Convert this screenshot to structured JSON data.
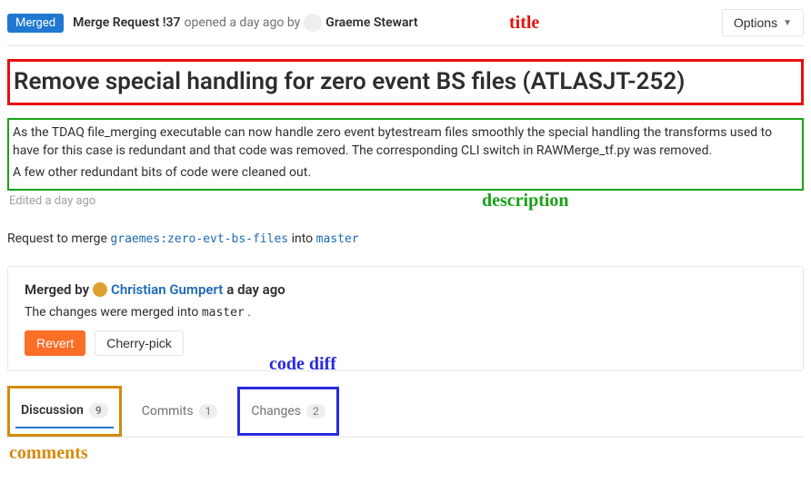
{
  "header": {
    "status_badge": "Merged",
    "mr_label": "Merge Request !37",
    "opened_text": "opened a day ago by",
    "author": "Graeme Stewart"
  },
  "options": {
    "label": "Options"
  },
  "title": "Remove special handling for zero event BS files (ATLASJT-252)",
  "description": {
    "p1": "As the TDAQ file_merging executable can now handle zero event bytestream files smoothly the special handling the transforms used to have for this case is redundant and that code was removed. The corresponding CLI switch in RAWMerge_tf.py was removed.",
    "p2": "A few other redundant bits of code were cleaned out."
  },
  "edited_text": "Edited a day ago",
  "merge_request_line": {
    "prefix": "Request to merge",
    "src_user": "graemes",
    "src_branch": "zero-evt-bs-files",
    "into": "into",
    "target_branch": "master"
  },
  "merged_box": {
    "merged_by_label": "Merged by",
    "merged_user": "Christian Gumpert",
    "merged_when": "a day ago",
    "sub_prefix": "The changes were merged into",
    "sub_branch": "master",
    "sub_suffix": ".",
    "revert": "Revert",
    "cherry": "Cherry-pick"
  },
  "tabs": {
    "discussion": {
      "label": "Discussion",
      "count": "9"
    },
    "commits": {
      "label": "Commits",
      "count": "1"
    },
    "changes": {
      "label": "Changes",
      "count": "2"
    }
  },
  "annotations": {
    "title": "title",
    "description": "description",
    "code_diff": "code diff",
    "comments": "comments"
  }
}
